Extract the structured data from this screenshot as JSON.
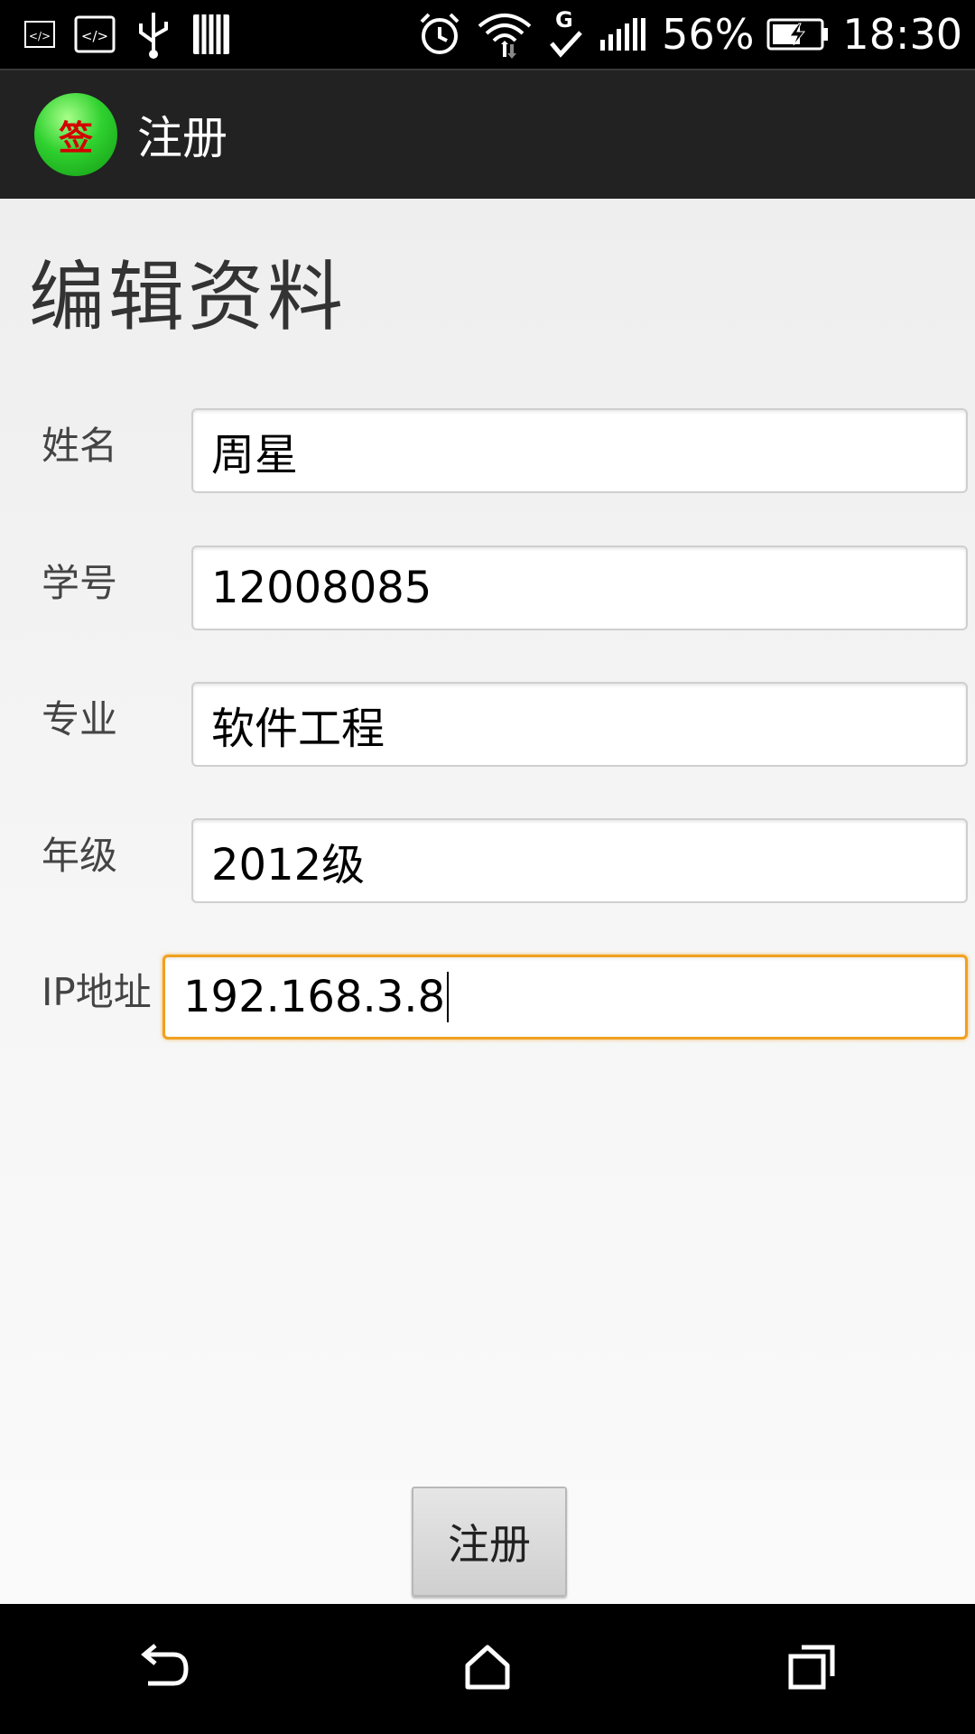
{
  "status_bar": {
    "battery_percent": "56%",
    "time": "18:30",
    "network_type": "G",
    "icons": [
      "code-icon",
      "code-box-icon",
      "usb-icon",
      "storage-icon",
      "alarm-icon",
      "wifi-icon",
      "network-g-icon",
      "signal-icon",
      "battery-charging-icon"
    ]
  },
  "action_bar": {
    "logo_text": "签",
    "title": "注册"
  },
  "page": {
    "title": "编辑资料"
  },
  "form": {
    "name_label": "姓名",
    "name_value": "周星",
    "student_id_label": "学号",
    "student_id_value": "12008085",
    "major_label": "专业",
    "major_value": "软件工程",
    "grade_label": "年级",
    "grade_value": "2012级",
    "ip_label": "IP地址",
    "ip_value": "192.168.3.8",
    "focused_border_color": "#f0a020"
  },
  "actions": {
    "register_label": "注册"
  },
  "nav_bar": {
    "buttons": [
      "back-icon",
      "home-icon",
      "recent-apps-icon"
    ]
  }
}
